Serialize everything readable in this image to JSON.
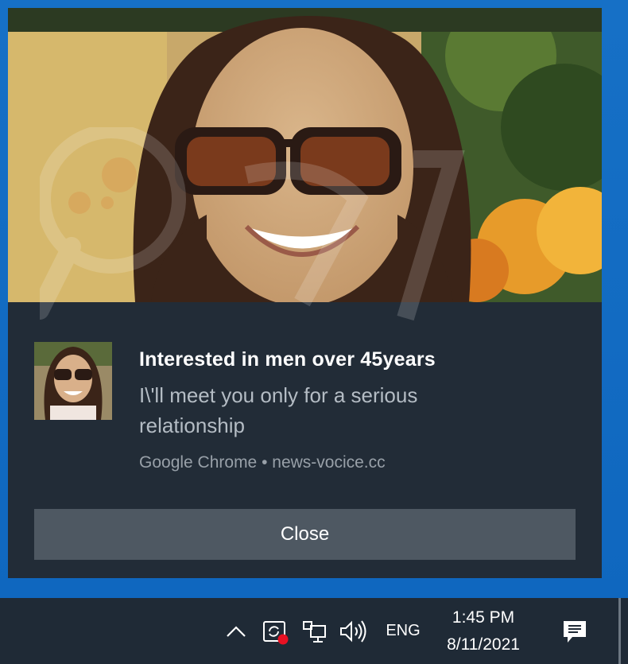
{
  "notification": {
    "title": "Interested in men over 45years",
    "message": "I\\'ll meet you only for a serious relationship",
    "attribution": "Google Chrome • news-vocice.cc",
    "close_label": "Close"
  },
  "taskbar": {
    "language": "ENG",
    "time": "1:45 PM",
    "date": "8/11/2021",
    "icons": [
      "chevron-up-icon",
      "update-alert-icon",
      "network-icon",
      "volume-icon",
      "action-center-icon"
    ]
  },
  "colors": {
    "desktop": "#1473c9",
    "toast_bg": "#222c37",
    "button_bg": "#4e5862",
    "taskbar_bg": "#1f2a36",
    "alert_dot": "#e81123"
  }
}
